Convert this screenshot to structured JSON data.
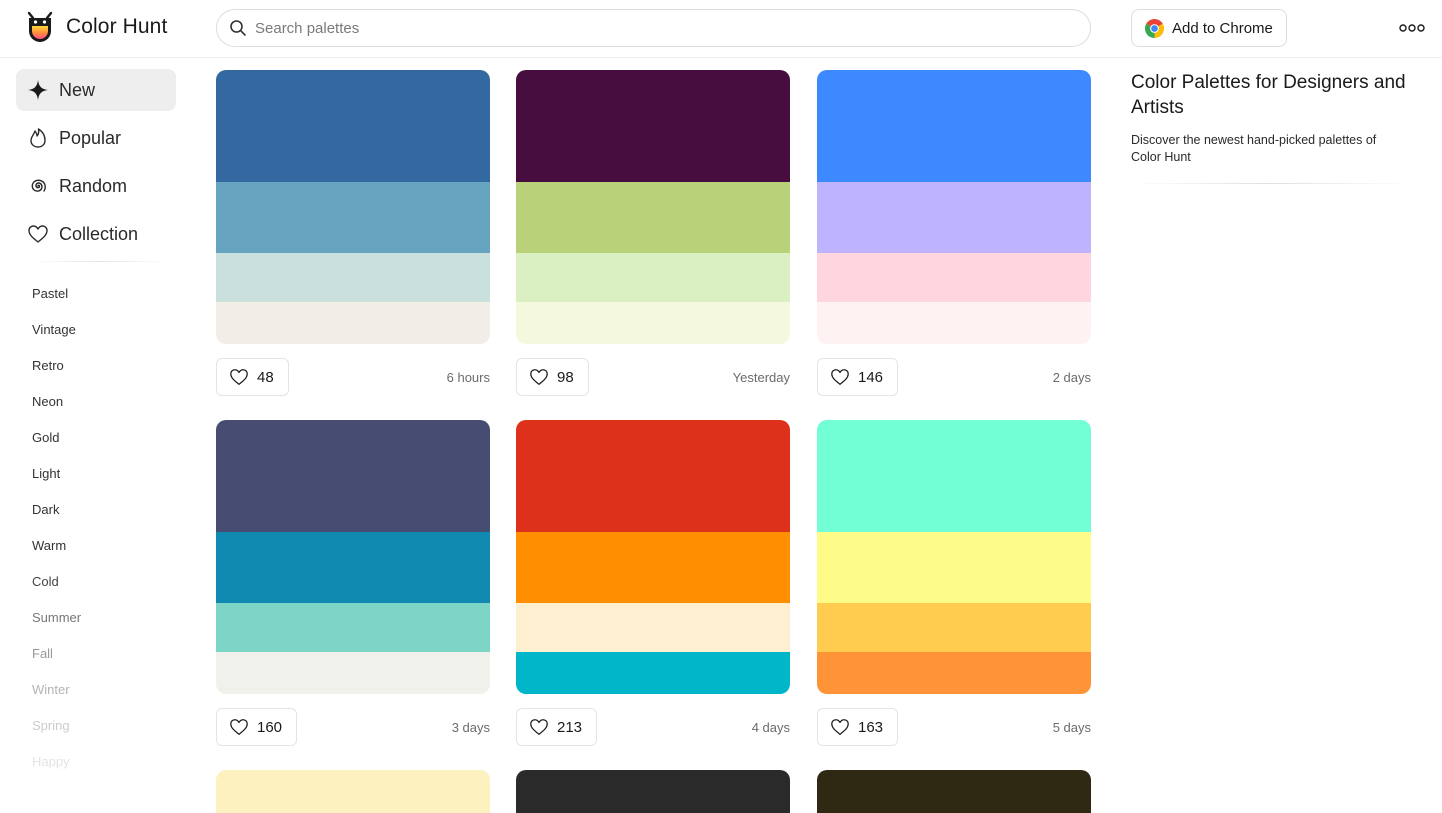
{
  "app": {
    "name": "Color Hunt"
  },
  "search": {
    "placeholder": "Search palettes"
  },
  "header": {
    "chrome_button": "Add to Chrome"
  },
  "sidebar": {
    "nav": [
      {
        "label": "New",
        "icon": "sparkle-icon",
        "active": true
      },
      {
        "label": "Popular",
        "icon": "flame-icon",
        "active": false
      },
      {
        "label": "Random",
        "icon": "spiral-icon",
        "active": false
      },
      {
        "label": "Collection",
        "icon": "heart-icon",
        "active": false
      }
    ],
    "tags": [
      "Pastel",
      "Vintage",
      "Retro",
      "Neon",
      "Gold",
      "Light",
      "Dark",
      "Warm",
      "Cold",
      "Summer",
      "Fall",
      "Winter",
      "Spring",
      "Happy"
    ]
  },
  "palettes": [
    {
      "colors": [
        "#3468A0",
        "#66A4C0",
        "#C9E0DC",
        "#F1EEE8"
      ],
      "likes": "48",
      "date": "6 hours"
    },
    {
      "colors": [
        "#470D3E",
        "#B9D27A",
        "#DAEFC2",
        "#F4F9DD"
      ],
      "likes": "98",
      "date": "Yesterday"
    },
    {
      "colors": [
        "#3D89FF",
        "#BEB3FF",
        "#FFD5DF",
        "#FFF2F2"
      ],
      "likes": "146",
      "date": "2 days"
    },
    {
      "colors": [
        "#464C72",
        "#118AB2",
        "#7DD5C6",
        "#F1F1EC"
      ],
      "likes": "160",
      "date": "3 days"
    },
    {
      "colors": [
        "#DE311C",
        "#FF8E00",
        "#FEEFD1",
        "#02B6CA"
      ],
      "likes": "213",
      "date": "4 days"
    },
    {
      "colors": [
        "#73FFD5",
        "#FDFC88",
        "#FFCC4F",
        "#FF9337"
      ],
      "likes": "163",
      "date": "5 days"
    }
  ],
  "peek_colors": [
    "#FDF1BF",
    "#2A2A2A",
    "#2F2914"
  ],
  "about": {
    "title": "Color Palettes for Designers and Artists",
    "description": "Discover the newest hand-picked palettes of Color Hunt"
  }
}
